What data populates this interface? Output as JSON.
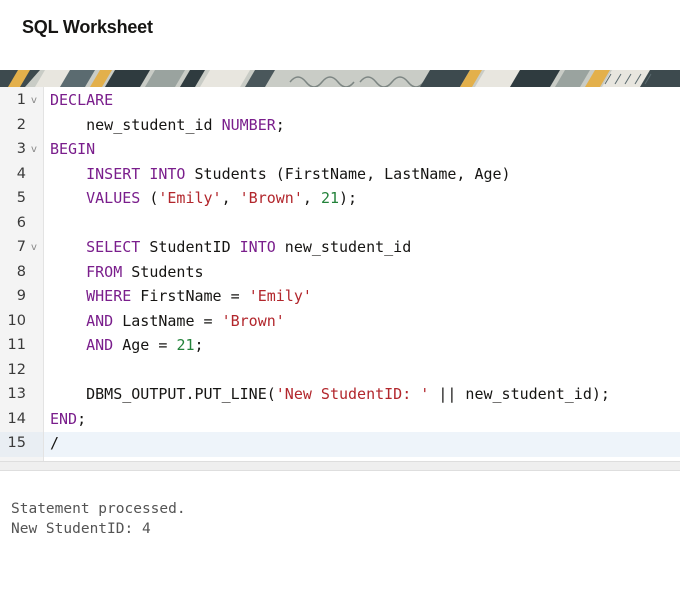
{
  "header": {
    "title": "SQL Worksheet"
  },
  "editor": {
    "lines": [
      {
        "number": "1",
        "fold": true,
        "tokens": [
          [
            "kw",
            "DECLARE"
          ]
        ]
      },
      {
        "number": "2",
        "fold": false,
        "tokens": [
          [
            "t",
            "    new_student_id "
          ],
          [
            "kw",
            "NUMBER"
          ],
          [
            "t",
            ";"
          ]
        ]
      },
      {
        "number": "3",
        "fold": true,
        "tokens": [
          [
            "kw",
            "BEGIN"
          ]
        ]
      },
      {
        "number": "4",
        "fold": false,
        "tokens": [
          [
            "t",
            "    "
          ],
          [
            "kw",
            "INSERT INTO"
          ],
          [
            "t",
            " Students (FirstName, LastName, Age)"
          ]
        ]
      },
      {
        "number": "5",
        "fold": false,
        "tokens": [
          [
            "t",
            "    "
          ],
          [
            "kw",
            "VALUES"
          ],
          [
            "t",
            " ("
          ],
          [
            "str",
            "'Emily'"
          ],
          [
            "t",
            ", "
          ],
          [
            "str",
            "'Brown'"
          ],
          [
            "t",
            ", "
          ],
          [
            "num",
            "21"
          ],
          [
            "t",
            ");"
          ]
        ]
      },
      {
        "number": "6",
        "fold": false,
        "tokens": []
      },
      {
        "number": "7",
        "fold": true,
        "tokens": [
          [
            "t",
            "    "
          ],
          [
            "kw",
            "SELECT"
          ],
          [
            "t",
            " StudentID "
          ],
          [
            "kw",
            "INTO"
          ],
          [
            "t",
            " new_student_id"
          ]
        ]
      },
      {
        "number": "8",
        "fold": false,
        "tokens": [
          [
            "t",
            "    "
          ],
          [
            "kw",
            "FROM"
          ],
          [
            "t",
            " Students"
          ]
        ]
      },
      {
        "number": "9",
        "fold": false,
        "tokens": [
          [
            "t",
            "    "
          ],
          [
            "kw",
            "WHERE"
          ],
          [
            "t",
            " FirstName = "
          ],
          [
            "str",
            "'Emily'"
          ]
        ]
      },
      {
        "number": "10",
        "fold": false,
        "tokens": [
          [
            "t",
            "    "
          ],
          [
            "kw",
            "AND"
          ],
          [
            "t",
            " LastName = "
          ],
          [
            "str",
            "'Brown'"
          ]
        ]
      },
      {
        "number": "11",
        "fold": false,
        "tokens": [
          [
            "t",
            "    "
          ],
          [
            "kw",
            "AND"
          ],
          [
            "t",
            " Age = "
          ],
          [
            "num",
            "21"
          ],
          [
            "t",
            ";"
          ]
        ]
      },
      {
        "number": "12",
        "fold": false,
        "tokens": []
      },
      {
        "number": "13",
        "fold": false,
        "tokens": [
          [
            "t",
            "    DBMS_OUTPUT.PUT_LINE("
          ],
          [
            "str",
            "'New StudentID: '"
          ],
          [
            "t",
            " || new_student_id);"
          ]
        ]
      },
      {
        "number": "14",
        "fold": false,
        "tokens": [
          [
            "kw",
            "END"
          ],
          [
            "t",
            ";"
          ]
        ]
      },
      {
        "number": "15",
        "fold": false,
        "tokens": [
          [
            "t",
            "/"
          ]
        ],
        "active": true
      }
    ],
    "fold_icon": "chevron-down-icon",
    "colors": {
      "keyword": "#7a1e8c",
      "string": "#b2262c",
      "number": "#23823a"
    }
  },
  "output": {
    "lines": [
      "Statement processed.",
      "New StudentID: 4"
    ]
  }
}
